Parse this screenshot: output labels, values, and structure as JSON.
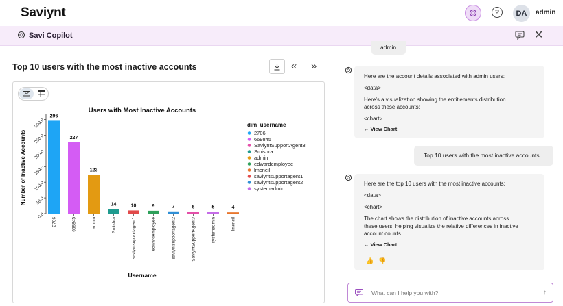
{
  "header": {
    "logo": "Saviynt",
    "avatar_initials": "DA",
    "user_name": "admin",
    "help_label": "?"
  },
  "copilot_bar": {
    "title": "Savi Copilot"
  },
  "left_panel": {
    "title": "Top 10 users with the most inactive accounts",
    "nav_prev": "«",
    "nav_next": "»"
  },
  "chart_data": {
    "type": "bar",
    "title": "Users with Most Inactive Accounts",
    "xlabel": "Username",
    "ylabel": "Number of Inactive Accounts",
    "categories": [
      "2706",
      "669845",
      "admin",
      "Smishra",
      "saviyntsupportagent1",
      "edwardemployee",
      "saviyntsupportagent2",
      "SaviyntSupportAgent3",
      "systemadmin",
      "lmcneil"
    ],
    "values": [
      296,
      227,
      123,
      14,
      10,
      9,
      7,
      6,
      5,
      4
    ],
    "colors": [
      "#1ea5f5",
      "#d45cf4",
      "#e39a12",
      "#1f9b8f",
      "#e24a4a",
      "#2ea05a",
      "#2f8fd6",
      "#e44fa9",
      "#c56ce8",
      "#e8762c"
    ],
    "yticks": [
      "0.0",
      "50.0",
      "100.0",
      "150.0",
      "200.0",
      "250.0",
      "300.0"
    ],
    "ylim": [
      0,
      310
    ],
    "grid": false,
    "legend": {
      "title": "dim_username",
      "position": "right",
      "entries": [
        {
          "label": "2706",
          "color": "#1ea5f5"
        },
        {
          "label": "669845",
          "color": "#d45cf4"
        },
        {
          "label": "SaviyntSupportAgent3",
          "color": "#e44fa9"
        },
        {
          "label": "Smishra",
          "color": "#1f9b8f"
        },
        {
          "label": "admin",
          "color": "#e39a12"
        },
        {
          "label": "edwardemployee",
          "color": "#2ea05a"
        },
        {
          "label": "lmcneil",
          "color": "#e8762c"
        },
        {
          "label": "saviyntsupportagent1",
          "color": "#e24a4a"
        },
        {
          "label": "saviyntsupportagent2",
          "color": "#2f8fd6"
        },
        {
          "label": "systemadmin",
          "color": "#c56ce8"
        }
      ]
    }
  },
  "chat": {
    "msg0_user": "admin",
    "msg1_bot": {
      "lines": [
        "Here are the account details associated with admin users:",
        "<data>",
        "Here's a visualization showing the entitlements distribution",
        "across these accounts:",
        "<chart>"
      ],
      "view_chart": "← View Chart"
    },
    "msg2_user": "Top 10 users with the most inactive accounts",
    "msg3_bot": {
      "lines": [
        "Here are the top 10 users with the most inactive accounts:",
        "<data>",
        "<chart>",
        "The chart shows the distribution of inactive accounts across",
        "these users, helping visualize the relative differences in inactive",
        "account counts."
      ],
      "view_chart": "← View Chart"
    },
    "thumbs_up": "👍",
    "thumbs_down": "👎",
    "input_placeholder": "What can I help you with?",
    "send_glyph": "↑"
  },
  "colors": {
    "accent": "#c98de2",
    "copilot_bar_bg": "#f7ecfa"
  }
}
